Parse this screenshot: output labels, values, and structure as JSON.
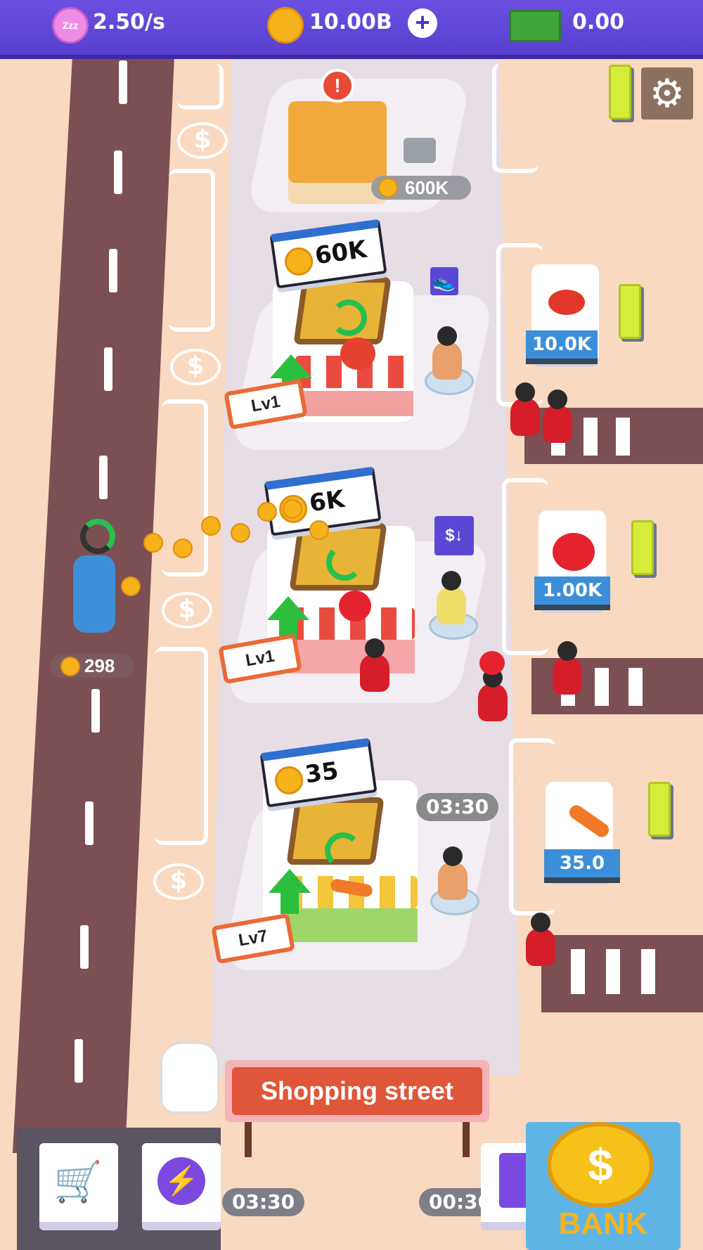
{
  "topbar": {
    "income_rate": "2.50/s",
    "coins": "10.00B",
    "add_symbol": "+",
    "cash": "0.00",
    "sleep_icon_text": "Zzz"
  },
  "locked_shop": {
    "price": "600K",
    "alert": "!"
  },
  "shops": [
    {
      "upgrade_price": "60K",
      "level": "Lv1",
      "boost_icon": "speed-shoe-icon"
    },
    {
      "upgrade_price": "6K",
      "level": "Lv1",
      "boost_icon": "price-down-icon",
      "boost_text": "$↓"
    },
    {
      "upgrade_price": "35",
      "level": "Lv7",
      "timer": "03:30"
    }
  ],
  "products": [
    {
      "name_icon": "meat-icon",
      "price": "10.0K"
    },
    {
      "name_icon": "apple-icon",
      "price": "1.00K"
    },
    {
      "name_icon": "carrot-icon",
      "price": "35.0"
    }
  ],
  "delivery": {
    "coins": "298"
  },
  "street_sign": "Shopping street",
  "bottom": {
    "timer_left": "03:30",
    "timer_right": "00:30",
    "bank_label": "BANK"
  },
  "road_dollar": "$",
  "colors": {
    "topbar": "#5940cf",
    "road": "#7b4f53",
    "sign": "#e0563a",
    "coin": "#f6b21a"
  }
}
